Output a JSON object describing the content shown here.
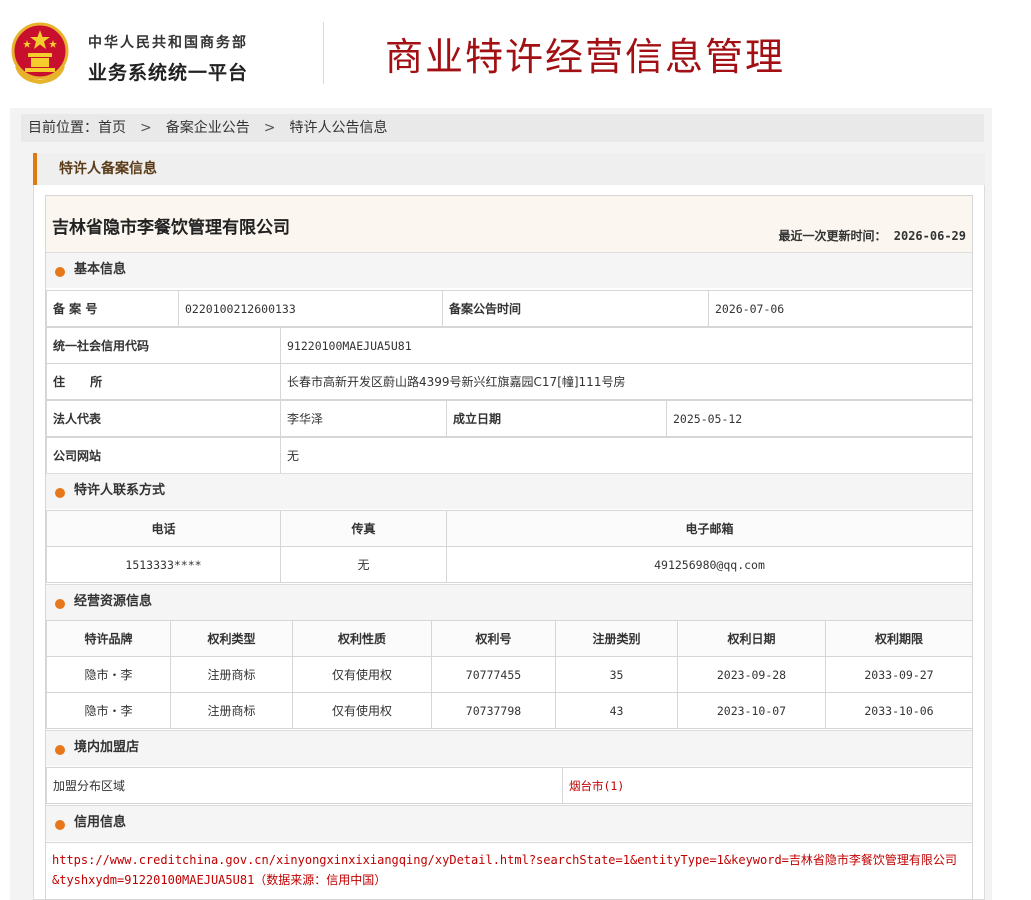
{
  "header": {
    "org_line1": "中华人民共和国商务部",
    "org_line2": "业务系统统一平台",
    "site_title": "商业特许经营信息管理"
  },
  "breadcrumb": {
    "prefix": "目前位置：",
    "items": [
      "首页",
      "备案企业公告",
      "特许人公告信息"
    ],
    "separator": ">"
  },
  "panel": {
    "title": "特许人备案信息"
  },
  "company": {
    "name": "吉林省隐市李餐饮管理有限公司",
    "update_label": "最近一次更新时间：",
    "update_value": "2026-06-29"
  },
  "basic": {
    "title": "基本信息",
    "record_no_label": "备 案 号",
    "record_no": "0220100212600133",
    "announce_time_label": "备案公告时间",
    "announce_time": "2026-07-06",
    "credit_code_label": "统一社会信用代码",
    "credit_code": "91220100MAEJUA5U81",
    "address_label": "住      所",
    "address": "长春市高新开发区蔚山路4399号新兴红旗嘉园C17[幢]111号房",
    "legal_rep_label": "法人代表",
    "legal_rep": "李华泽",
    "founded_label": "成立日期",
    "founded": "2025-05-12",
    "website_label": "公司网站",
    "website": "无"
  },
  "contact": {
    "title": "特许人联系方式",
    "headers": [
      "电话",
      "传真",
      "电子邮箱"
    ],
    "phone": "1513333****",
    "fax": "无",
    "email": "491256980@qq.com"
  },
  "resources": {
    "title": "经营资源信息",
    "headers": [
      "特许品牌",
      "权利类型",
      "权利性质",
      "权利号",
      "注册类别",
      "权利日期",
      "权利期限"
    ],
    "rows": [
      [
        "隐市・李",
        "注册商标",
        "仅有使用权",
        "70777455",
        "35",
        "2023-09-28",
        "2033-09-27"
      ],
      [
        "隐市・李",
        "注册商标",
        "仅有使用权",
        "70737798",
        "43",
        "2023-10-07",
        "2033-10-06"
      ]
    ]
  },
  "domestic": {
    "title": "境内加盟店",
    "region_label": "加盟分布区域",
    "region_value": "烟台市(1)"
  },
  "credit": {
    "title": "信用信息",
    "url_line": "https://www.creditchina.gov.cn/xinyongxinxixiangqing/xyDetail.html?searchState=1&entityType=1&keyword=吉林省隐市李餐饮管理有限公司&tyshxydm=91220100MAEJUA5U81（数据来源：信用中国）"
  },
  "colors": {
    "brand_red": "#a21014",
    "accent_orange": "#e8761a",
    "link_red": "#c00000"
  }
}
